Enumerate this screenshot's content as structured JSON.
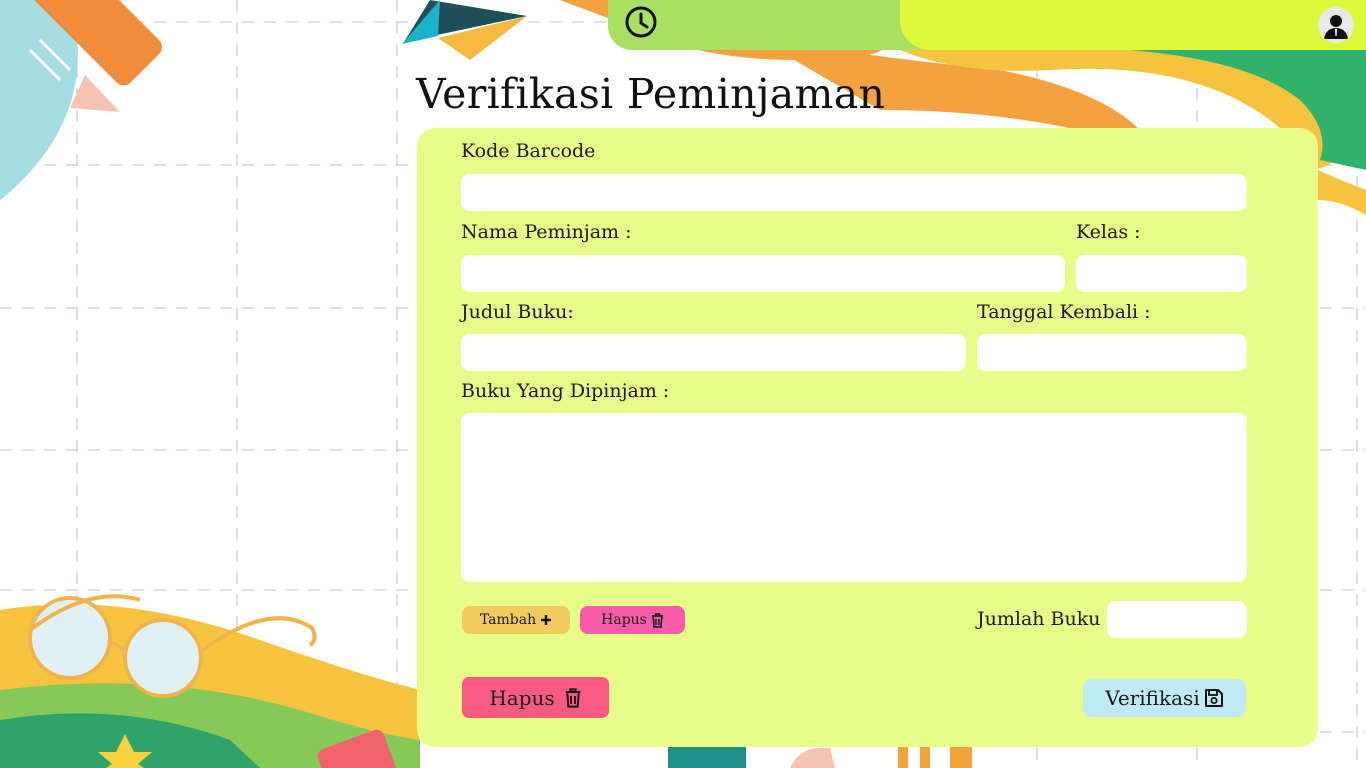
{
  "header": {
    "clock_icon": "clock-icon",
    "avatar_icon": "user-avatar-icon"
  },
  "page": {
    "title": "Verifikasi Peminjaman"
  },
  "form": {
    "kode_barcode_label": "Kode Barcode",
    "kode_barcode_value": "",
    "nama_peminjam_label": "Nama Peminjam :",
    "nama_peminjam_value": "",
    "kelas_label": "Kelas :",
    "kelas_value": "",
    "judul_buku_label": "Judul Buku:",
    "judul_buku_value": "",
    "tanggal_kembali_label": "Tanggal Kembali :",
    "tanggal_kembali_value": "",
    "buku_dipinjam_label": "Buku Yang Dipinjam :",
    "buku_dipinjam_value": "",
    "jumlah_buku_label": "Jumlah Buku :",
    "jumlah_buku_value": ""
  },
  "actions": {
    "tambah_label": "Tambah",
    "tambah_icon": "plus-icon",
    "hapus_small_label": "Hapus",
    "hapus_small_icon": "trash-icon",
    "hapus_label": "Hapus",
    "hapus_icon": "trash-icon",
    "verifikasi_label": "Verifikasi",
    "verifikasi_icon": "save-icon"
  },
  "colors": {
    "panel": "#e7fc89",
    "topbar_green": "#a8e061",
    "topbar_yellow": "#def93b",
    "tambah_button": "#f2cb5d",
    "hapus_small_button": "#f75ca9",
    "hapus_button": "#fb5b82",
    "verifikasi_button": "#bfe9f4"
  }
}
